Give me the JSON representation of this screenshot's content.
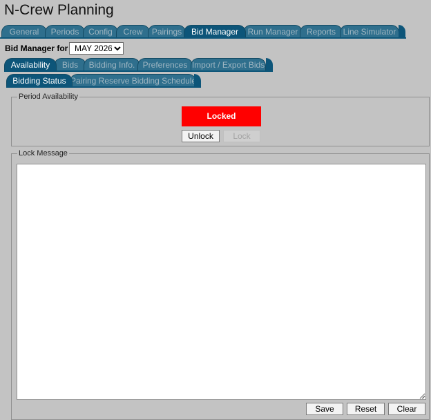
{
  "app": {
    "title": "N-Crew Planning"
  },
  "main_tabs": [
    {
      "label": "General",
      "active": false
    },
    {
      "label": "Periods",
      "active": false
    },
    {
      "label": "Config",
      "active": false
    },
    {
      "label": "Crew",
      "active": false
    },
    {
      "label": "Pairings",
      "active": false
    },
    {
      "label": "Bid Manager",
      "active": true
    },
    {
      "label": "Run Manager",
      "active": false
    },
    {
      "label": "Reports",
      "active": false
    },
    {
      "label": "Line Simulator",
      "active": false
    }
  ],
  "bid_manager": {
    "label": "Bid Manager for",
    "period_select": {
      "selected": "MAY 2026"
    }
  },
  "sub_tabs": [
    {
      "label": "Availability",
      "active": true
    },
    {
      "label": "Bids",
      "active": false
    },
    {
      "label": "Bidding Info.",
      "active": false
    },
    {
      "label": "Preferences",
      "active": false
    },
    {
      "label": "Import / Export Bids",
      "active": false
    }
  ],
  "third_tabs": [
    {
      "label": "Bidding Status",
      "active": true
    },
    {
      "label": "Pairing Reserve Bidding Schedule",
      "active": false
    }
  ],
  "period_availability": {
    "legend": "Period Availability",
    "status": "Locked",
    "status_color": "#ff0000",
    "unlock_label": "Unlock",
    "lock_label": "Lock"
  },
  "lock_message": {
    "legend": "Lock Message",
    "value": "",
    "save_label": "Save",
    "reset_label": "Reset",
    "clear_label": "Clear"
  },
  "colors": {
    "background": "#c3c3c3",
    "tab_active": "#0d5579",
    "tab_inactive": "#2f6f8d"
  }
}
